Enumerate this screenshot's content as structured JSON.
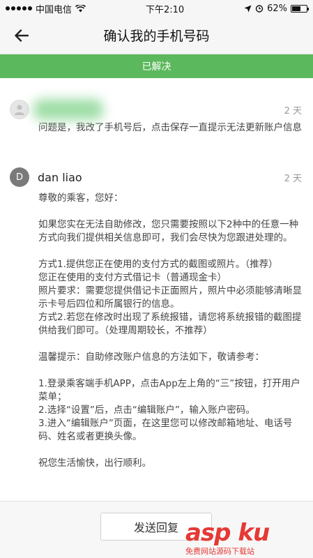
{
  "status_bar": {
    "carrier": "中国电信",
    "time": "下午2:10",
    "battery": "62%",
    "battery_level": 0.62
  },
  "nav": {
    "title": "确认我的手机号码"
  },
  "banner": {
    "status": "已解决"
  },
  "messages": [
    {
      "time": "2 天",
      "body": "问题是，我改了手机号后，点击保存一直提示无法更新账户信息"
    },
    {
      "avatar_letter": "D",
      "name": "dan liao",
      "time": "2 天",
      "paragraphs": [
        "尊敬的乘客，您好：",
        "如果您实在无法自助修改，您只需要按照以下2种中的任意一种方式向我们提供相关信息即可，我们会尽快为您跟进处理的。",
        "方式1.提供您正在使用的支付方式的截图或照片。（推荐）",
        "您正在使用的支付方式借记卡（普通现金卡）",
        "照片要求：需要您提供借记卡正面照片，照片中必须能够清晰显示卡号后四位和所属银行的信息。",
        "方式2.若您在修改时出现了系统报错，请您将系统报错的截图提供给我们即可。（处理周期较长，不推荐）",
        "温馨提示：自助修改账户信息的方法如下，敬请参考：",
        "1.登录乘客端手机APP，点击App左上角的“三”按钮，打开用户菜单；",
        "2.选择“设置”后，点击“编辑账户”，输入账户密码。",
        "3.进入“编辑账户”页面，在这里您可以修改邮箱地址、电话号码、姓名或者更换头像。",
        "祝您生活愉快，出行顺利。"
      ]
    }
  ],
  "footer": {
    "reply_label": "发送回复"
  },
  "watermark": {
    "logo": "asp ku",
    "subtitle": "免费网站源码下载站"
  },
  "colors": {
    "banner_green": "#5cb85c",
    "watermark_red": "#e53935"
  }
}
